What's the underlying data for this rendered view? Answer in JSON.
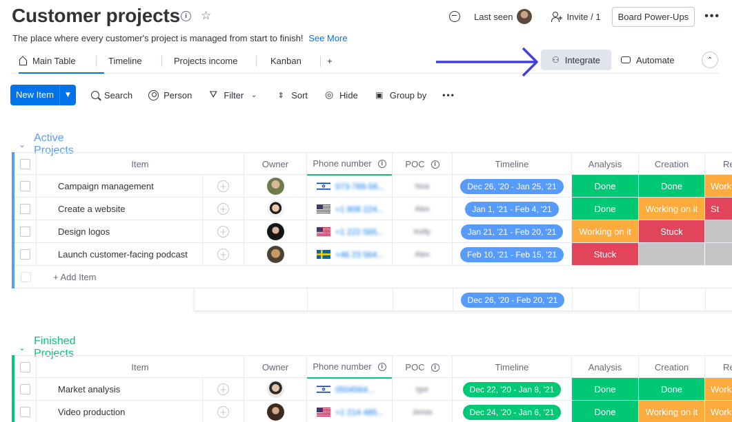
{
  "header": {
    "title": "Customer projects",
    "subtitle": "The place where every customer's project is managed from start to finish!",
    "see_more": "See More",
    "last_seen": "Last seen",
    "invite": "Invite / 1",
    "power_ups": "Board Power-Ups"
  },
  "tabs": {
    "main_table": "Main Table",
    "timeline": "Timeline",
    "projects_income": "Projects income",
    "kanban": "Kanban",
    "add": "+",
    "integrate": "Integrate",
    "automate": "Automate"
  },
  "toolbar": {
    "new_item": "New Item",
    "search": "Search",
    "person": "Person",
    "filter": "Filter",
    "sort": "Sort",
    "hide": "Hide",
    "group_by": "Group by"
  },
  "columns": {
    "item": "Item",
    "owner": "Owner",
    "phone": "Phone number",
    "poc": "POC",
    "timeline": "Timeline",
    "analysis": "Analysis",
    "creation": "Creation",
    "re": "Re"
  },
  "colors": {
    "done": "#00c875",
    "working": "#fdab3d",
    "stuck": "#e2445c",
    "empty": "#c4c4c4",
    "active_group": "#579bfc",
    "finished_group": "#00c875",
    "timeline_active": "#579bfc",
    "timeline_finished": "#00c875"
  },
  "groups": {
    "active": {
      "name": "Active Projects",
      "add_item": "+ Add Item",
      "summary_timeline": "Dec 26, '20 - Feb 20, '21",
      "rows": [
        {
          "item": "Campaign management",
          "flag": "il",
          "phone": "073-789-56...",
          "poc": "Noa",
          "timeline": "Dec 26, '20 - Jan 25, '21",
          "analysis": "Done",
          "creation": "Done",
          "re": "Worki"
        },
        {
          "item": "Create a website",
          "flag": "us",
          "phone": "+1 808 224...",
          "poc": "Alex",
          "timeline": "Jan 1, '21 - Feb 4, '21",
          "analysis": "Done",
          "creation": "Working on it",
          "re": "St"
        },
        {
          "item": "Design logos",
          "flag": "us",
          "phone": "+1 222 565...",
          "poc": "Kelly",
          "timeline": "Jan 21, '21 - Feb 20, '21",
          "analysis": "Working on it",
          "creation": "Stuck",
          "re": ""
        },
        {
          "item": "Launch customer-facing podcast",
          "flag": "se",
          "phone": "+46 23 564...",
          "poc": "Alex",
          "timeline": "Feb 10, '21 - Feb 15, '21",
          "analysis": "Stuck",
          "creation": "",
          "re": ""
        }
      ]
    },
    "finished": {
      "name": "Finished Projects",
      "rows": [
        {
          "item": "Market analysis",
          "flag": "il",
          "phone": "0504564...",
          "poc": "Igor",
          "timeline": "Dec 22, '20 - Jan 8, '21",
          "analysis": "Done",
          "creation": "Done",
          "re": "Worki"
        },
        {
          "item": "Video production",
          "flag": "us",
          "phone": "+1 214 485...",
          "poc": "Jonas",
          "timeline": "Dec 24, '20 - Jan 6, '21",
          "analysis": "Done",
          "creation": "Working on it",
          "re": "Worki"
        }
      ]
    }
  }
}
